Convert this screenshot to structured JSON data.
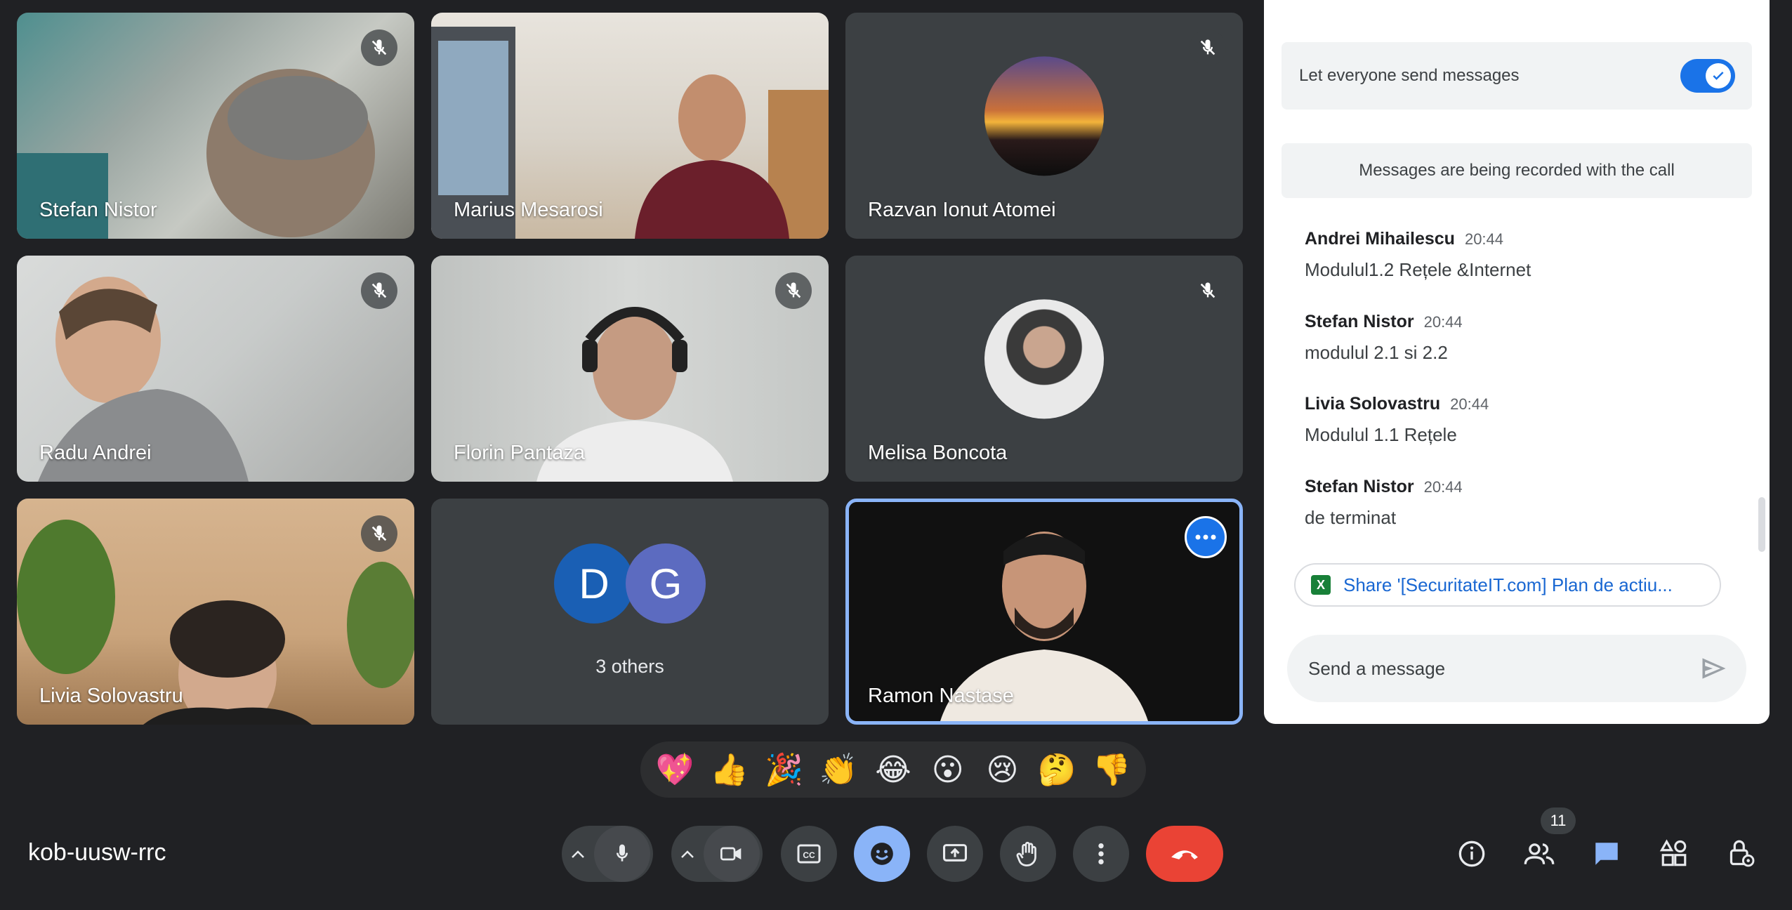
{
  "participants": [
    {
      "name": "Stefan Nistor",
      "muted": true
    },
    {
      "name": "Marius Mesarosi",
      "muted": false
    },
    {
      "name": "Razvan Ionut Atomei",
      "muted": true
    },
    {
      "name": "Radu Andrei",
      "muted": true
    },
    {
      "name": "Florin Pantaza",
      "muted": true
    },
    {
      "name": "Melisa Boncota",
      "muted": true
    },
    {
      "name": "Livia Solovastru",
      "muted": true
    },
    {
      "name": "Ramon Nastase",
      "muted": false,
      "active_speaker": true
    }
  ],
  "others_tile": {
    "initials": [
      "D",
      "G"
    ],
    "colors": [
      "#1a5fb4",
      "#5c6bc0"
    ],
    "label": "3 others"
  },
  "chat": {
    "permission_label": "Let everyone send messages",
    "permission_enabled": true,
    "recording_notice": "Messages are being recorded with the call",
    "messages": [
      {
        "sender": "Andrei Mihailescu",
        "time": "20:44",
        "text": "Modulul1.2 Rețele &Internet"
      },
      {
        "sender": "Stefan Nistor",
        "time": "20:44",
        "text": "modulul 2.1 si 2.2"
      },
      {
        "sender": "Livia Solovastru",
        "time": "20:44",
        "text": "Modulul 1.1 Rețele"
      },
      {
        "sender": "Stefan Nistor",
        "time": "20:44",
        "text": "de terminat"
      }
    ],
    "share_chip": "Share '[SecuritateIT.com] Plan de actiu...",
    "share_chip_icon": "X",
    "composer_placeholder": "Send a message"
  },
  "reactions": [
    "💖",
    "👍",
    "🎉",
    "👏",
    "😂",
    "😮",
    "😢",
    "🤔",
    "👎"
  ],
  "meeting": {
    "code": "kob-uusw-rrc",
    "participant_count": "11"
  },
  "colors": {
    "accent": "#1a73e8",
    "hangup": "#ea4335",
    "active_border": "#8ab4f8",
    "bar_bg": "#202124"
  }
}
